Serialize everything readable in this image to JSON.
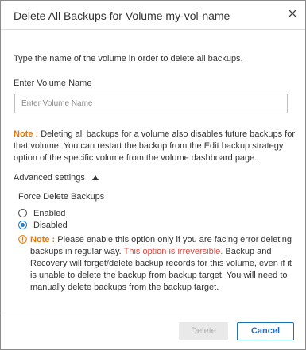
{
  "dialog": {
    "title": "Delete All Backups for Volume my-vol-name",
    "close_icon": "close-icon"
  },
  "intro_text": "Type the name of the volume in order to delete all backups.",
  "volume_name": {
    "label": "Enter Volume Name",
    "placeholder": "Enter Volume Name",
    "value": ""
  },
  "note": {
    "label": "Note :",
    "text": " Deleting all backups for a volume also disables future backups for that volume. You can restart the backup from the Edit backup strategy option of the specific volume from the volume dashboard page."
  },
  "advanced": {
    "label": "Advanced settings",
    "expanded": true,
    "icon": "caret-up-icon"
  },
  "force_delete": {
    "label": "Force Delete Backups",
    "options": [
      {
        "label": "Enabled",
        "selected": false
      },
      {
        "label": "Disabled",
        "selected": true
      }
    ]
  },
  "warning": {
    "icon": "warning-circle-icon",
    "label": "Note :",
    "text_before": " Please enable this option only if you are facing error deleting backups in regular way. ",
    "irreversible": "This option is irreversible.",
    "text_after": " Backup and Recovery will forget/delete backup records for this volume, even if it is unable to delete the backup from backup target. You will need to manually delete backups from the backup target."
  },
  "footer": {
    "delete_label": "Delete",
    "cancel_label": "Cancel"
  },
  "colors": {
    "note_label": "#e8760a",
    "irreversible": "#e0463f",
    "primary": "#1f6fbf",
    "radio_selected": "#1f78d1"
  }
}
